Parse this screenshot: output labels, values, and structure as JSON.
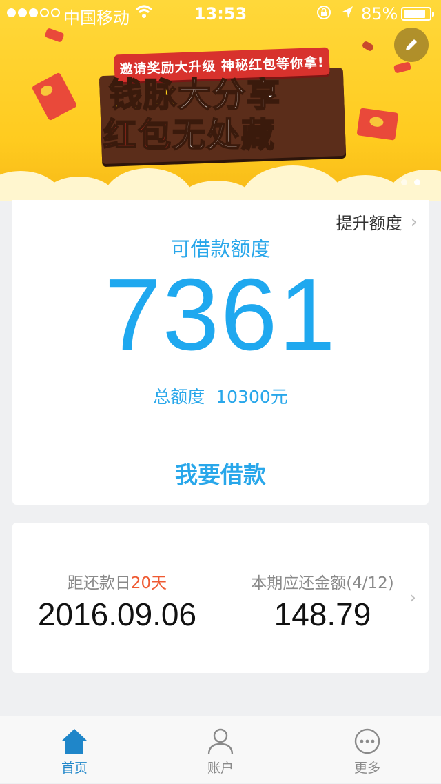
{
  "status_bar": {
    "carrier": "中国移动",
    "time": "13:53",
    "battery_pct_text": "85%",
    "battery_level": 0.85,
    "signal_bars_filled": 3,
    "signal_bars_total": 5
  },
  "banner": {
    "ribbon_text": "邀请奖励大升级  神秘红包等你拿!",
    "headline_1a": "钱脉",
    "headline_1b": "大分享",
    "headline_2a": "红包",
    "headline_2b": "无处藏",
    "page_indicator": {
      "count": 2,
      "active_index": 1
    }
  },
  "credit": {
    "raise_limit_label": "提升额度",
    "available_label": "可借款额度",
    "available_amount": "7361",
    "total_label": "总额度",
    "total_value": "10300元",
    "borrow_button": "我要借款"
  },
  "repay": {
    "due_label_prefix": "距还款日",
    "due_days": "20天",
    "due_date": "2016.09.06",
    "amount_label": "本期应还金额(4/12)",
    "amount_value": "148.79"
  },
  "tabs": [
    {
      "label": "首页",
      "icon": "home-icon",
      "active": true
    },
    {
      "label": "账户",
      "icon": "person-icon",
      "active": false
    },
    {
      "label": "更多",
      "icon": "more-icon",
      "active": false
    }
  ],
  "colors": {
    "accent": "#29a7ea",
    "amount": "#1fa8ef",
    "highlight": "#ef5a32",
    "banner": "#ffcb1f",
    "tab_active": "#1f86c9"
  }
}
